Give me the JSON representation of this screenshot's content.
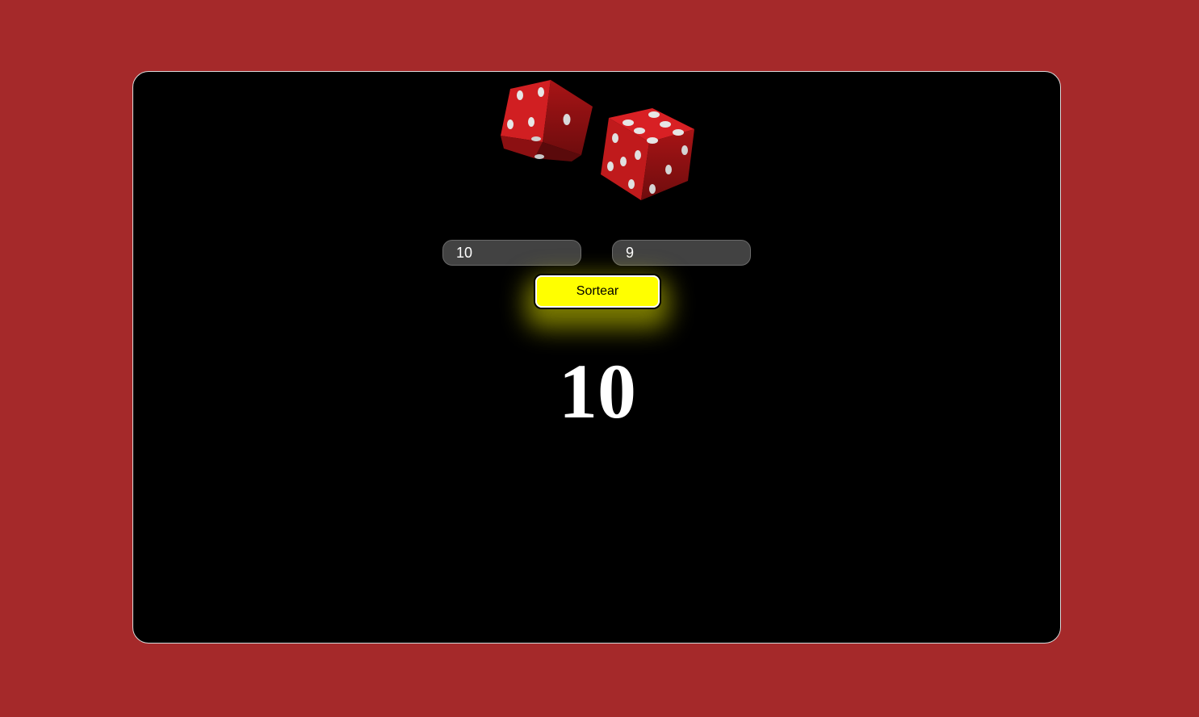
{
  "app": {
    "min_value": "10",
    "max_value": "9",
    "button_label": "Sortear",
    "result": "10"
  },
  "colors": {
    "page_background": "#a5292a",
    "card_background": "#000000",
    "button_background": "#ffff00",
    "die_color": "#c81a1c",
    "pip_color": "#e6e6e6"
  },
  "icons": {
    "dice": "dice-icon"
  }
}
